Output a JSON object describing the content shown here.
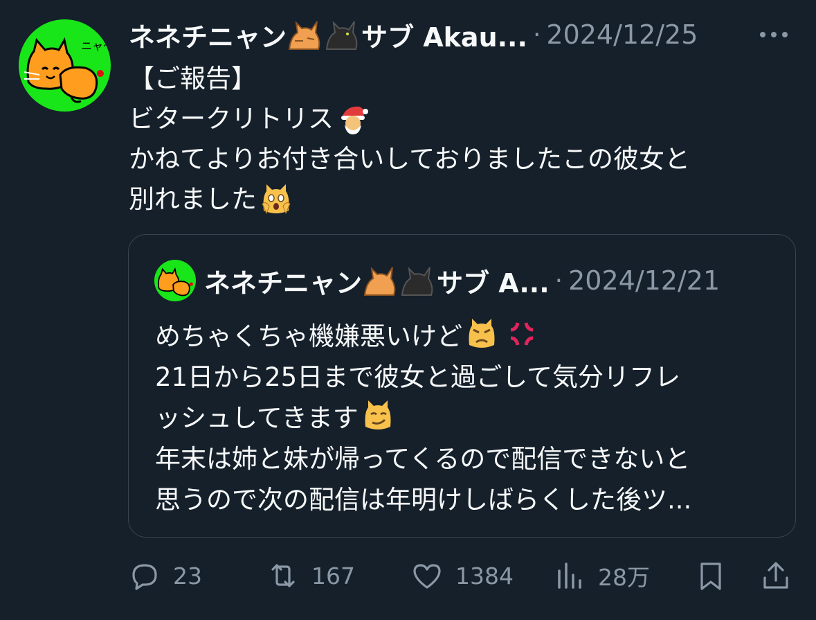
{
  "tweet": {
    "display_name": "ネネチニャン",
    "display_name_suffix": "サブ Akau...",
    "date": "2024/12/25",
    "separator": "·",
    "lines": [
      "【ご報告】",
      "ビタークリトリス",
      "かねてよりお付き合いしておりましたこの彼女と",
      "別れました"
    ]
  },
  "quoted_tweet": {
    "display_name": "ネネチニャン",
    "display_name_suffix": "サブ A...",
    "date": "2024/12/21",
    "separator": "·",
    "lines": [
      "めちゃくちゃ機嫌悪いけど",
      "21日から25日まで彼女と過ごして気分リフレ",
      "ッシュしてきます",
      "年末は姉と妹が帰ってくるので配信できないと",
      "思うので次の配信は年明けしばらくした後ツ..."
    ]
  },
  "avatar_caption": "ニャ〜",
  "actions": {
    "reply_count": "23",
    "repost_count": "167",
    "like_count": "1384",
    "views_count": "28万"
  },
  "icons": {
    "more": "more-dots-icon",
    "reply": "reply-icon",
    "repost": "repost-icon",
    "like": "like-icon",
    "views": "views-icon",
    "bookmark": "bookmark-icon",
    "share": "share-icon"
  },
  "colors": {
    "background": "#15202b",
    "text": "#f7f9f9",
    "muted": "#8b98a5",
    "border": "#38444d",
    "avatar_bg": "#19e619"
  }
}
